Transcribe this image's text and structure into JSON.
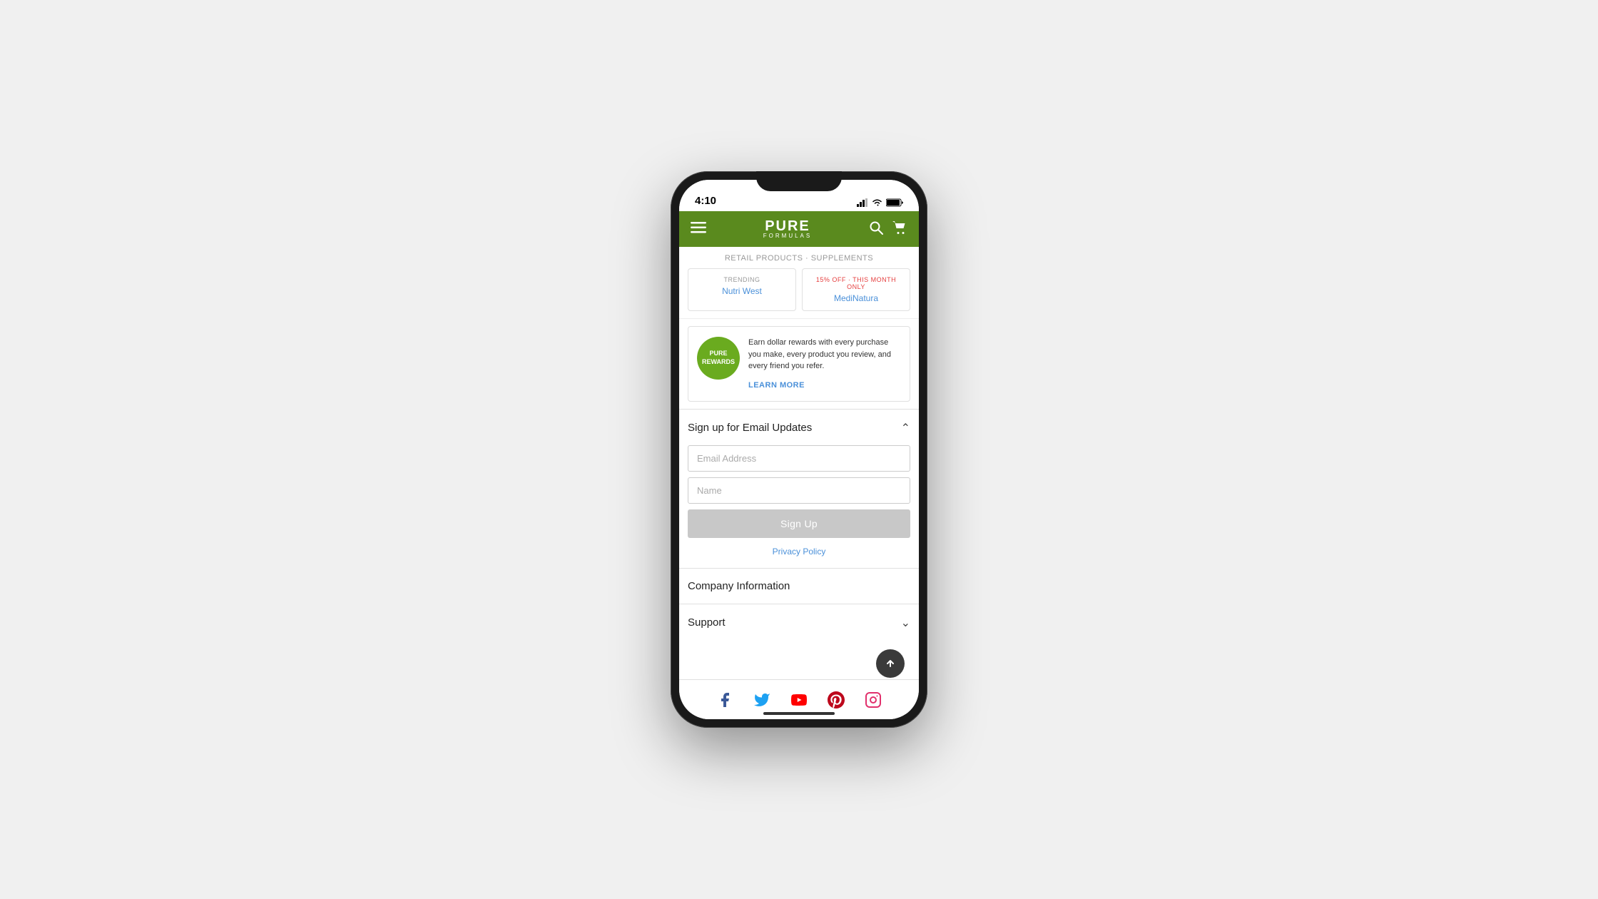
{
  "statusBar": {
    "time": "4:10"
  },
  "nav": {
    "logoLine1": "PURE",
    "logoLine2": "FORMULAS"
  },
  "trending": {
    "headerText": "RETAIL PRODUCTS · SUPPLEMENTS",
    "card1": {
      "label": "TRENDING",
      "brand": "Nutri West"
    },
    "card2": {
      "label": "15% OFF · THIS MONTH ONLY",
      "brand": "MediNatura"
    }
  },
  "rewards": {
    "logoLine1": "PURE",
    "logoLine2": "REWARDS",
    "description": "Earn dollar rewards with every purchase you make, every product you review, and every friend you refer.",
    "linkText": "LEARN MORE"
  },
  "emailSignup": {
    "title": "Sign up for Email Updates",
    "emailPlaceholder": "Email Address",
    "namePlaceholder": "Name",
    "buttonLabel": "Sign Up",
    "privacyLinkText": "Privacy Policy"
  },
  "companyInfo": {
    "title": "Company Information"
  },
  "support": {
    "title": "Support"
  },
  "social": {
    "icons": [
      "facebook",
      "twitter",
      "youtube",
      "pinterest",
      "instagram"
    ]
  }
}
